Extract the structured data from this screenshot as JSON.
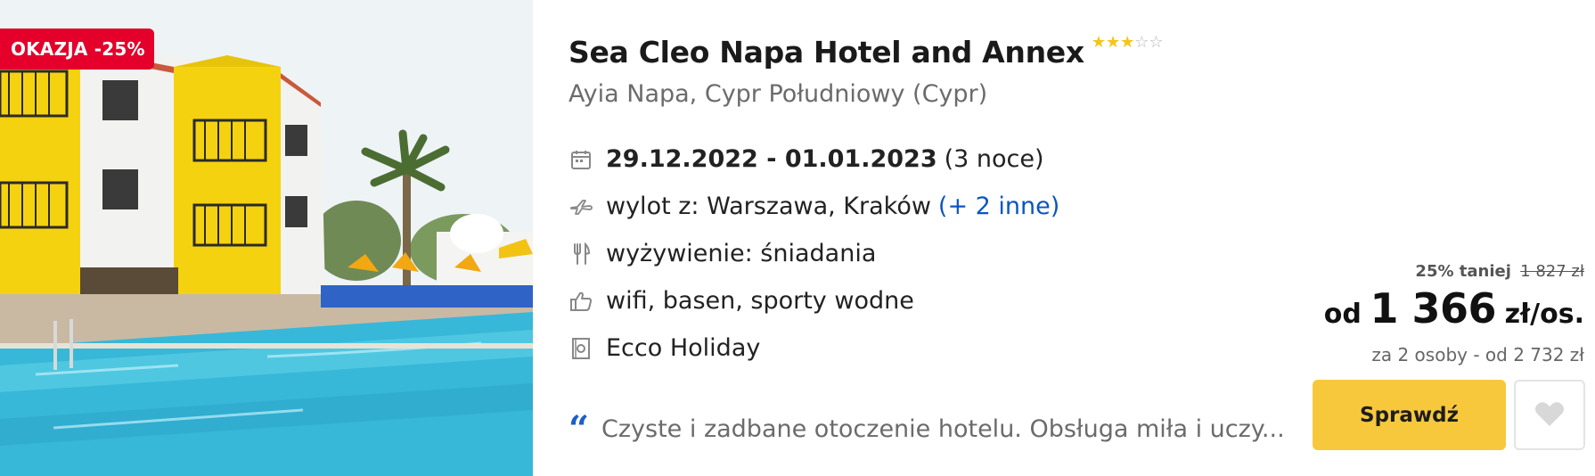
{
  "badge": {
    "label": "OKAZJA -25%"
  },
  "hotel": {
    "name": "Sea Cleo Napa Hotel and Annex",
    "stars": 3,
    "stars_max": 5,
    "location": "Ayia Napa, Cypr Południowy (Cypr)"
  },
  "facts": {
    "dates": "29.12.2022 - 01.01.2023",
    "nights": "(3 noce)",
    "departure": "wylot z: Warszawa, Kraków",
    "departure_more": "(+ 2 inne)",
    "board": "wyżywienie: śniadania",
    "amenities": "wifi, basen, sporty wodne",
    "operator": "Ecco Holiday"
  },
  "icons": {
    "dates": "calendar-icon",
    "departure": "plane-icon",
    "board": "fork-knife-icon",
    "amenities": "thumbs-up-icon",
    "operator": "operator-icon",
    "quote": "quote-icon",
    "favorite": "heart-icon"
  },
  "review": {
    "text": "Czyste i zadbane otoczenie hotelu. Obsługa miła i uczy..."
  },
  "price": {
    "discount_text": "25% taniej",
    "old_price": "1 827 zł",
    "prefix": "od",
    "amount": "1 366",
    "unit": "zł/os.",
    "per_people": "za 2 osoby - od 2 732 zł"
  },
  "actions": {
    "check_label": "Sprawdź"
  },
  "colors": {
    "deal_red": "#e4002b",
    "button_yellow": "#f7c83c",
    "link_blue": "#0a56c2",
    "star_gold": "#f5c518"
  }
}
